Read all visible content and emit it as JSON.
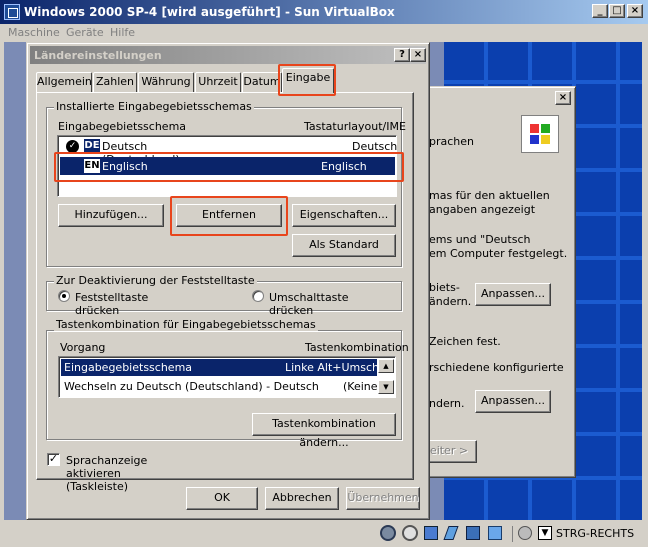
{
  "host": {
    "title": "Windows 2000 SP-4 [wird ausgeführt] - Sun VirtualBox",
    "controls": {
      "minimize": "_",
      "maximize": "□",
      "close": "×"
    },
    "menu": [
      "Maschine",
      "Geräte",
      "Hilfe"
    ],
    "status_text": "STRG-RECHTS"
  },
  "back_dialog": {
    "close": "×",
    "texts": [
      "prachen",
      "mas für den aktuellen",
      "angaben angezeigt",
      "ems und \"Deutsch",
      "em Computer festgelegt.",
      "biets-",
      "ändern.",
      "Zeichen fest.",
      "rschiedene konfigurierte",
      "ndern."
    ],
    "adjust1": "Anpassen...",
    "adjust2": "Anpassen...",
    "next": "eiter >"
  },
  "dialog": {
    "title": "Ländereinstellungen",
    "help": "?",
    "close": "×",
    "tabs": [
      "Allgemein",
      "Zahlen",
      "Währung",
      "Uhrzeit",
      "Datum",
      "Eingabe"
    ],
    "installed": {
      "group": "Installierte Eingabegebietsschemas",
      "col1": "Eingabegebietsschema",
      "col2": "Tastaturlayout/IME",
      "rows": [
        {
          "code": "DE",
          "name": "Deutsch (Deutschland)",
          "layout": "Deutsch"
        },
        {
          "code": "EN",
          "name": "Englisch (USA)",
          "layout": "Englisch (USA)"
        }
      ],
      "add": "Hinzufügen...",
      "remove": "Entfernen",
      "props": "Eigenschaften...",
      "default": "Als Standard"
    },
    "capslock": {
      "group": "Zur Deaktivierung der Feststelltaste",
      "opt1": "Feststelltaste drücken",
      "opt2": "Umschalttaste drücken"
    },
    "hotkeys": {
      "group": "Tastenkombination für Eingabegebietsschemas",
      "col1": "Vorgang",
      "col2": "Tastenkombination",
      "rows": [
        {
          "action": "Eingabegebietsschema wechseln",
          "key": "Linke Alt+Umschalt"
        },
        {
          "action": "Wechseln zu Deutsch (Deutschland) - Deutsch",
          "key": "(Keine)"
        }
      ],
      "change": "Tastenkombination ändern..."
    },
    "indicator": "Sprachanzeige aktivieren (Taskleiste)",
    "ok": "OK",
    "cancel": "Abbrechen",
    "apply": "Übernehmen"
  }
}
